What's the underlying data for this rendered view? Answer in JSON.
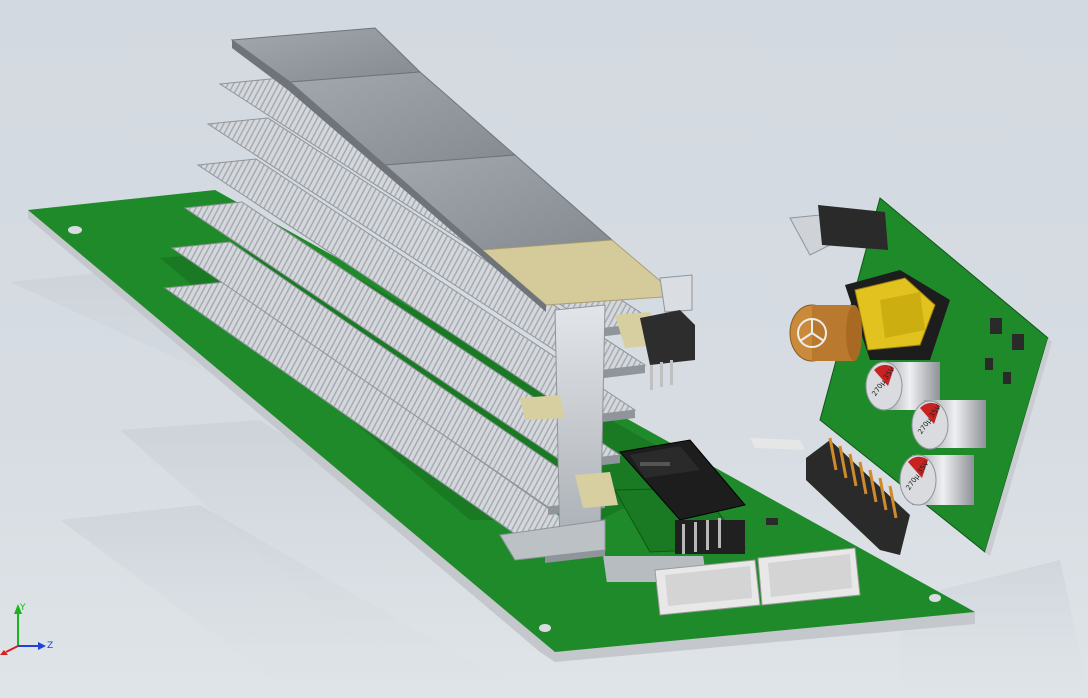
{
  "viewport": {
    "background_top": "#d3d9e0",
    "background_bottom": "#dfe4e8"
  },
  "colors": {
    "pcb": "#1f8a2a",
    "pcb_dark": "#146b1d",
    "pcb_edge": "#c9ccd0",
    "heatsink": "#cfd3d8",
    "heatsink_dark": "#9aa0a7",
    "thermal_pad": "#8a8f96",
    "thermal_pad_top": "#9ea3aa",
    "kapton": "#d8cfa0",
    "connector": "#e6e6e6",
    "capacitor": "#cfd1d4",
    "transformer": "#e1c21e",
    "axis_x": "#d62020",
    "axis_y": "#1bb31b",
    "axis_z": "#2040d8"
  },
  "triad": {
    "y_label": "Y",
    "z_label": "Z"
  },
  "components": {
    "cap_label": "270μ 35V"
  }
}
